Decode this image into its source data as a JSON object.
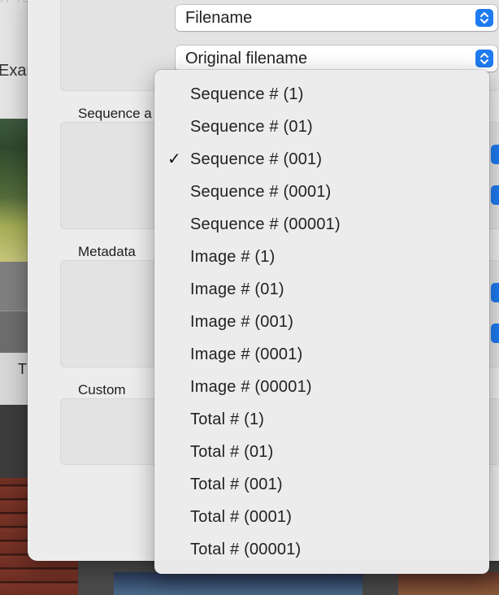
{
  "background": {
    "faded_title": "n Te",
    "partial_text": "Exam",
    "partial_t": "T"
  },
  "dialog": {
    "top_popups": [
      {
        "label": "Filename"
      },
      {
        "label": "Original filename"
      }
    ],
    "groups": {
      "sequence_label": "Sequence a",
      "metadata_label": "Metadata",
      "custom_label": "Custom"
    },
    "edge_text": "n"
  },
  "menu": {
    "selected_index": 2,
    "check_glyph": "✓",
    "items": [
      "Sequence # (1)",
      "Sequence # (01)",
      "Sequence # (001)",
      "Sequence # (0001)",
      "Sequence # (00001)",
      "Image # (1)",
      "Image # (01)",
      "Image # (001)",
      "Image # (0001)",
      "Image # (00001)",
      "Total # (1)",
      "Total # (01)",
      "Total # (001)",
      "Total # (0001)",
      "Total # (00001)"
    ]
  },
  "colors": {
    "accent": "#1e7bf0",
    "dialog_bg": "#ececec",
    "menu_bg": "#ececec"
  },
  "icons": {
    "popup_chevron": "up-down-chevron-icon",
    "checkmark": "checkmark-icon"
  }
}
